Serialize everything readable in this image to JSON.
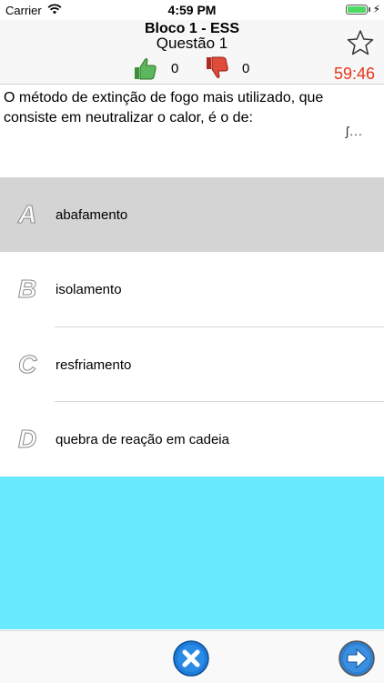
{
  "status_bar": {
    "carrier": "Carrier",
    "time": "4:59 PM",
    "icons": [
      "wifi-icon",
      "battery-icon",
      "charging-bolt-icon"
    ]
  },
  "header": {
    "title": "Bloco 1 - ESS",
    "subtitle": "Questão 1",
    "likes": "0",
    "dislikes": "0",
    "timer": "59:46",
    "icons": [
      "thumbs-up-icon",
      "thumbs-down-icon",
      "star-icon"
    ]
  },
  "question": {
    "text": "O método de extinção de fogo mais utilizado, que consiste em neutralizar o calor, é o de:",
    "more": "ʃ..."
  },
  "options": [
    {
      "letter": "A",
      "text": "abafamento",
      "selected": true
    },
    {
      "letter": "B",
      "text": "isolamento",
      "selected": false
    },
    {
      "letter": "C",
      "text": "resfriamento",
      "selected": false
    },
    {
      "letter": "D",
      "text": "quebra de reação em cadeia",
      "selected": false
    }
  ],
  "colors": {
    "accent_cyan": "#69e9fd",
    "timer_red": "#e8341c",
    "selected_row": "#d4d4d4",
    "button_blue": "#1e7bd8"
  },
  "toolbar": {
    "icons": [
      "close-icon",
      "next-arrow-icon"
    ]
  }
}
